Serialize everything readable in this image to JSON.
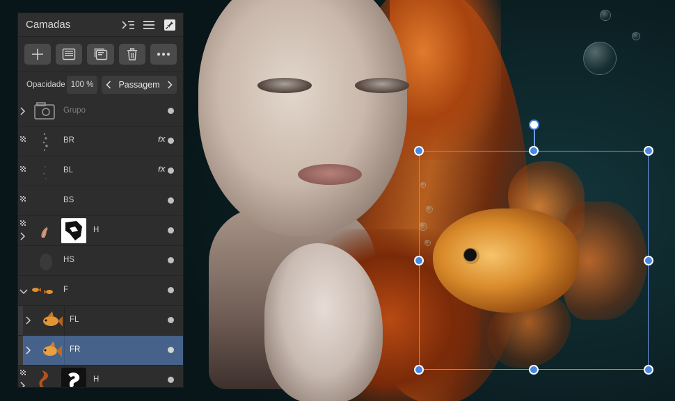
{
  "panel": {
    "title": "Camadas",
    "header_icons": [
      "child-layers-icon",
      "menu-icon",
      "pin-icon"
    ],
    "toolbar": [
      {
        "name": "add-layer-button",
        "icon": "plus-icon"
      },
      {
        "name": "add-adjustment-button",
        "icon": "adjustment-icon"
      },
      {
        "name": "add-group-button",
        "icon": "group-icon"
      },
      {
        "name": "delete-layer-button",
        "icon": "trash-icon"
      },
      {
        "name": "more-button",
        "icon": "more-icon"
      }
    ],
    "opacity_label": "Opacidade",
    "opacity_value": "100 %",
    "blend_mode": "Passagem"
  },
  "layers": [
    {
      "name": "Grupo",
      "dim": true,
      "expander": "collapsed",
      "thumb": "group",
      "fx": false
    },
    {
      "name": "BR",
      "dim": false,
      "checker": true,
      "thumb": "bubbles",
      "fx": true
    },
    {
      "name": "BL",
      "dim": false,
      "checker": true,
      "thumb": "bubbles-faint",
      "fx": true
    },
    {
      "name": "BS",
      "dim": false,
      "checker": true,
      "thumb": "empty",
      "fx": false
    },
    {
      "name": "H",
      "dim": false,
      "checker": true,
      "expander": "collapsed",
      "thumb": "hair-strand",
      "mask": true
    },
    {
      "name": "HS",
      "dim": false,
      "thumb": "shadow",
      "fx": false
    },
    {
      "name": "F",
      "dim": false,
      "expander": "expanded",
      "thumb": "fish-pair",
      "fx": false
    },
    {
      "name": "FL",
      "dim": false,
      "expander": "collapsed",
      "thumb": "fish",
      "child": true
    },
    {
      "name": "FR",
      "dim": false,
      "expander": "collapsed",
      "thumb": "fish",
      "child": true,
      "selected": true
    },
    {
      "name": "H",
      "dim": false,
      "checker": true,
      "expander": "collapsed",
      "thumb": "hair-curl",
      "mask": true
    }
  ],
  "colors": {
    "panel_bg": "#2d2d2d",
    "selected_row": "#46628a",
    "selection_stroke": "#6d9be6",
    "handle_fill": "#4a87e0"
  }
}
